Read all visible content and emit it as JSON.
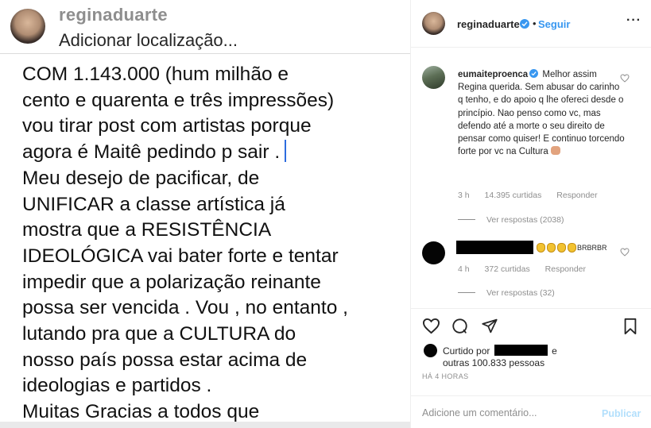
{
  "post_image": {
    "username": "reginaduarte",
    "location": "Adicionar localização...",
    "lines": [
      "COM  1.143.000 (hum  milhão e",
      "cento e quarenta e três impressões)",
      "vou tirar post com artistas porque",
      "agora é Maitê pedindo p sair .",
      "Meu desejo de pacificar, de",
      "UNIFICAR a classe  artística já",
      "mostra que a RESISTÊNCIA",
      "IDEOLÓGICA vai bater forte e tentar",
      "impedir que a polarização reinante",
      "possa ser vencida . Vou , no entanto ,",
      "lutando pra que a CULTURA do",
      "nosso país possa estar acima de",
      "ideologias e partidos .",
      "Muitas Gracias a todos que"
    ]
  },
  "header": {
    "username": "reginaduarte",
    "dot": "•",
    "follow_label": "Seguir",
    "more_icon": "more-horizontal-icon",
    "more_glyph": "···"
  },
  "comments": [
    {
      "username": "eumaiteproenca",
      "text": "Melhor assim Regina querida. Sem abusar do carinho q tenho, e do apoio q lhe ofereci desde o princípio. Nao penso como vc, mas defendo até a morte o seu direito de pensar como quiser! E continuo torcendo forte por vc na Cultura",
      "time": "3 h",
      "likes": "14.395 curtidas",
      "reply_label": "Responder",
      "view_replies": "Ver respostas (2038)"
    },
    {
      "username": "",
      "text_tail": "BRBRBR",
      "time": "4 h",
      "likes": "372 curtidas",
      "reply_label": "Responder",
      "view_replies": "Ver respostas (32)"
    }
  ],
  "actions": {
    "likes_prefix": "Curtido por",
    "likes_suffix": "e",
    "likes_line2": "outras 100.833 pessoas",
    "timestamp": "HÁ 4 HORAS",
    "comment_placeholder": "Adicione um comentário...",
    "publish_label": "Publicar"
  },
  "colors": {
    "accent_blue": "#3897f0",
    "publish_disabled": "#b2dffc",
    "muted_text": "#8e8e8e",
    "border": "#efefef"
  }
}
